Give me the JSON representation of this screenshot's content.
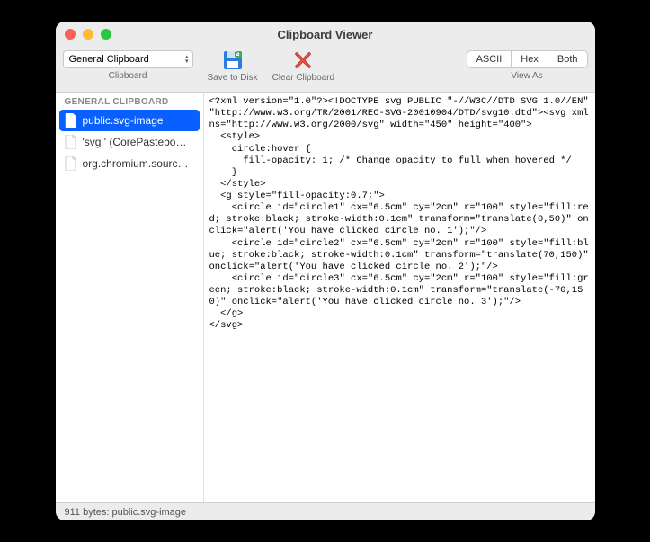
{
  "window": {
    "title": "Clipboard Viewer"
  },
  "toolbar": {
    "clipboard_dropdown": {
      "selected": "General Clipboard",
      "label": "Clipboard"
    },
    "save": {
      "label": "Save to Disk"
    },
    "clear": {
      "label": "Clear Clipboard"
    },
    "view_as": {
      "label": "View As",
      "options": [
        "ASCII",
        "Hex",
        "Both"
      ]
    }
  },
  "sidebar": {
    "header": "GENERAL CLIPBOARD",
    "items": [
      {
        "label": "public.svg-image",
        "selected": true
      },
      {
        "label": "'svg ' (CorePastebo…",
        "selected": false
      },
      {
        "label": "org.chromium.sourc…",
        "selected": false
      }
    ]
  },
  "content": {
    "text": "<?xml version=\"1.0\"?><!DOCTYPE svg PUBLIC \"-//W3C//DTD SVG 1.0//EN\" \"http://www.w3.org/TR/2001/REC-SVG-20010904/DTD/svg10.dtd\"><svg xmlns=\"http://www.w3.org/2000/svg\" width=\"450\" height=\"400\">\n  <style>\n    circle:hover {\n      fill-opacity: 1; /* Change opacity to full when hovered */\n    }\n  </style>\n  <g style=\"fill-opacity:0.7;\">\n    <circle id=\"circle1\" cx=\"6.5cm\" cy=\"2cm\" r=\"100\" style=\"fill:red; stroke:black; stroke-width:0.1cm\" transform=\"translate(0,50)\" onclick=\"alert('You have clicked circle no. 1');\"/>\n    <circle id=\"circle2\" cx=\"6.5cm\" cy=\"2cm\" r=\"100\" style=\"fill:blue; stroke:black; stroke-width:0.1cm\" transform=\"translate(70,150)\" onclick=\"alert('You have clicked circle no. 2');\"/>\n    <circle id=\"circle3\" cx=\"6.5cm\" cy=\"2cm\" r=\"100\" style=\"fill:green; stroke:black; stroke-width:0.1cm\" transform=\"translate(-70,150)\" onclick=\"alert('You have clicked circle no. 3');\"/>\n  </g>\n</svg>"
  },
  "statusbar": {
    "text": "911 bytes: public.svg-image"
  }
}
